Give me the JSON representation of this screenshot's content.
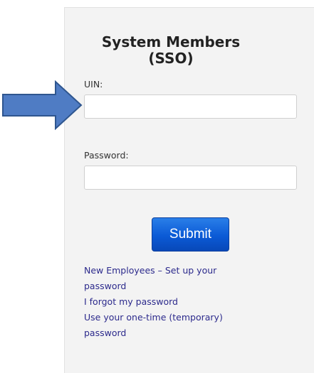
{
  "login": {
    "title_line1": "System Members",
    "title_line2": "(SSO)",
    "uin_label": "UIN:",
    "uin_value": "",
    "password_label": "Password:",
    "password_value": "",
    "submit_label": "Submit",
    "links": [
      {
        "line1": "New Employees – Set up your",
        "line2": "password"
      },
      {
        "line1": "I forgot my password"
      },
      {
        "line1": "Use your one-time (temporary)",
        "line2": "password"
      }
    ]
  },
  "annotation": {
    "arrow_icon": "right-arrow-icon",
    "arrow_fill": "#4f7cc4",
    "arrow_stroke": "#2f568f"
  },
  "colors": {
    "panel_bg": "#f3f3f3",
    "link": "#2c2a8c",
    "button": "#0b5ad6"
  }
}
